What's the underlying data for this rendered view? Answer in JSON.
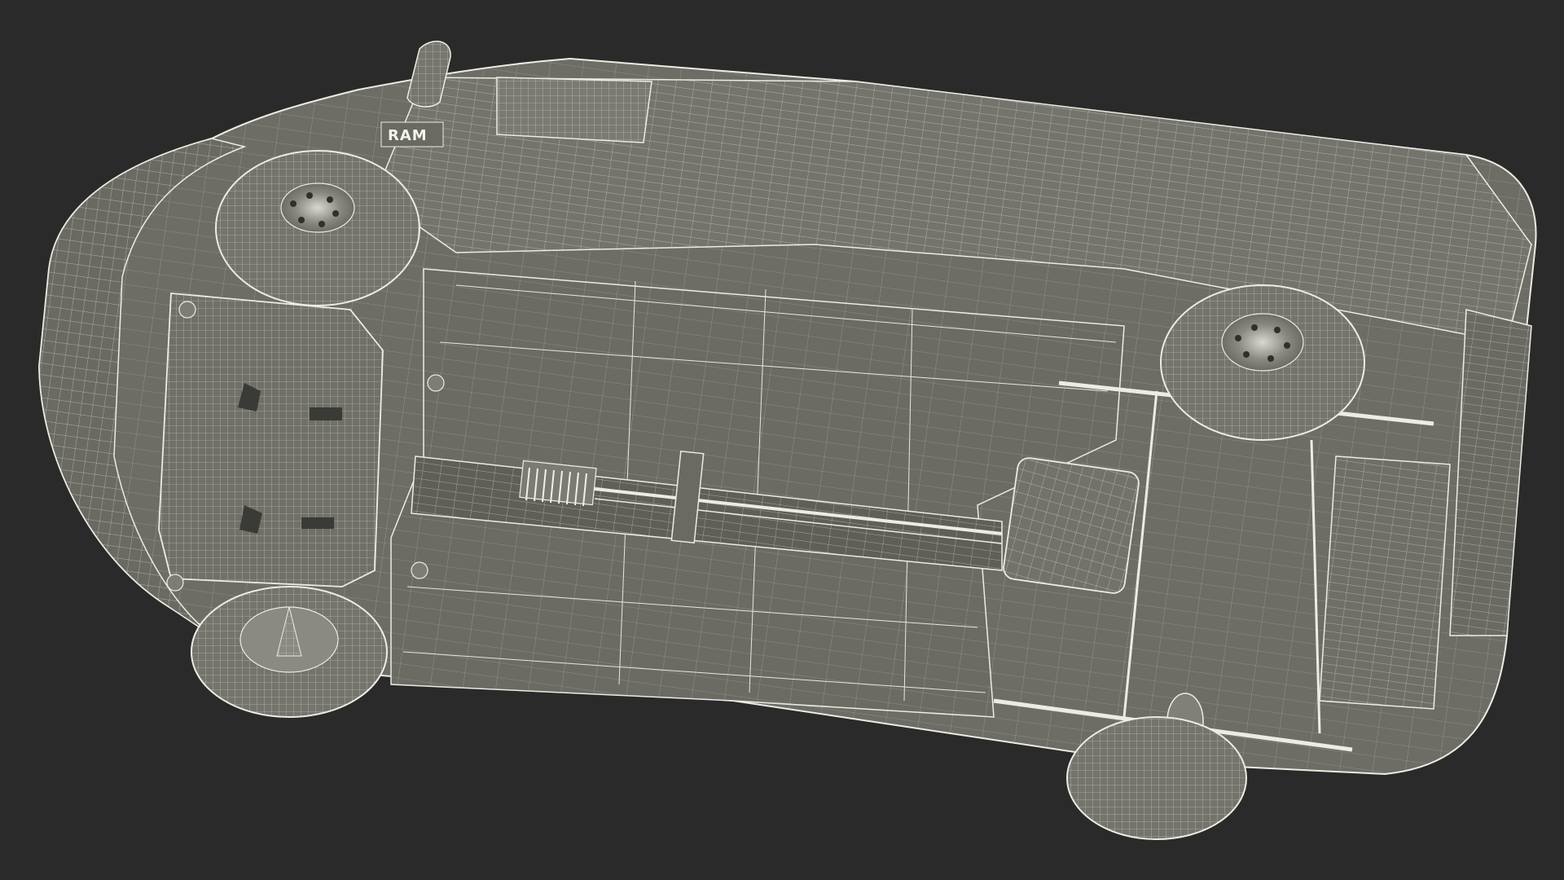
{
  "scene": {
    "subject": "van-underside-wireframe",
    "background_color": "#2a2a2a",
    "body_color": "#6f6f68",
    "body_shadow_color": "#5a5a54",
    "wire_color": "#e6e6df",
    "tire_color": "#727269"
  },
  "logo": {
    "text": "RAM"
  }
}
